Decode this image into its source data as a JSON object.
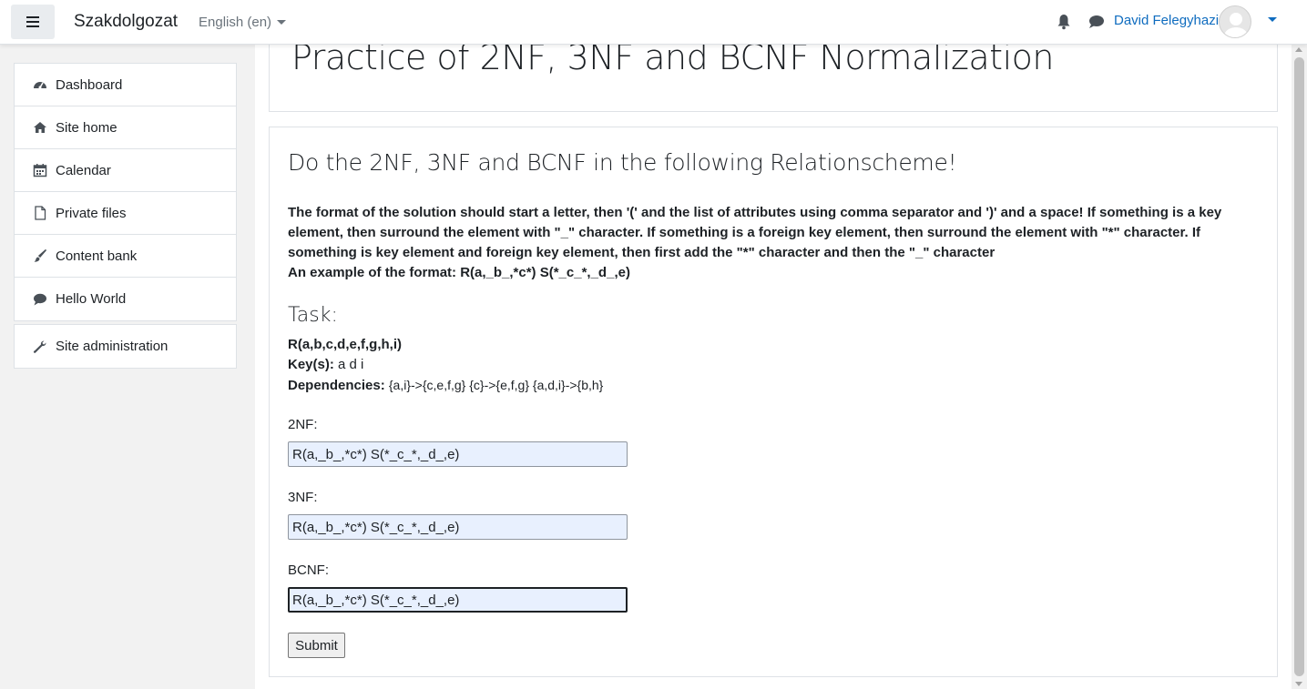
{
  "navbar": {
    "brand": "Szakdolgozat",
    "language": "English (en)",
    "user_name": "David Felegyhazi"
  },
  "sidebar": {
    "items": [
      {
        "label": "Dashboard",
        "icon": "dashboard-icon"
      },
      {
        "label": "Site home",
        "icon": "home-icon"
      },
      {
        "label": "Calendar",
        "icon": "calendar-icon"
      },
      {
        "label": "Private files",
        "icon": "file-icon"
      },
      {
        "label": "Content bank",
        "icon": "paintbrush-icon"
      },
      {
        "label": "Hello World",
        "icon": "chat-icon"
      }
    ],
    "admin": {
      "label": "Site administration",
      "icon": "wrench-icon"
    }
  },
  "page": {
    "title": "Practice of 2NF, 3NF and BCNF Normalization",
    "heading": "Do the 2NF, 3NF and BCNF in the following Relationscheme!",
    "instructions": "The format of the solution should start a letter, then '(' and the list of attributes using comma separator and ')' and a space! If something is a key element, then surround the element with \"_\" character. If something is a foreign key element, then surround the element with \"*\" character. If something is key element and foreign key element, then first add the \"*\" character and then the \"_\" character",
    "example": "An example of the format: R(a,_b_,*c*) S(*_c_*,_d_,e)",
    "task_title": "Task:",
    "relation": "R(a,b,c,d,e,f,g,h,i)",
    "keys_label": "Key(s):",
    "keys_value": "a d i",
    "deps_label": "Dependencies:",
    "deps_value": "{a,i}->{c,e,f,g} {c}->{e,f,g} {a,d,i}->{b,h}"
  },
  "form": {
    "nf2_label": "2NF:",
    "nf2_value": "R(a,_b_,*c*) S(*_c_*,_d_,e)",
    "nf3_label": "3NF:",
    "nf3_value": "R(a,_b_,*c*) S(*_c_*,_d_,e)",
    "bcnf_label": "BCNF:",
    "bcnf_value": "R(a,_b_,*c*) S(*_c_*,_d_,e)",
    "submit_label": "Submit"
  },
  "colors": {
    "link": "#0f6cbf",
    "autofill_bg": "#e8f0fe"
  }
}
